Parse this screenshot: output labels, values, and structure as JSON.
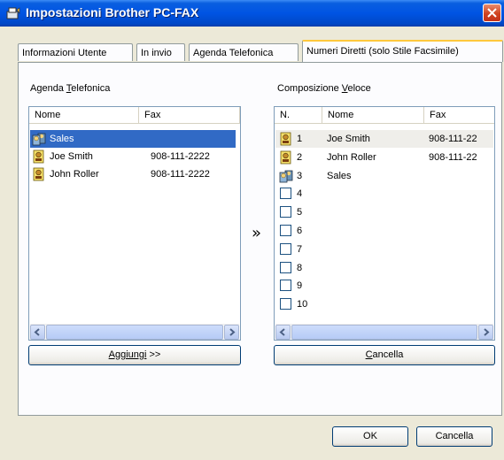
{
  "window": {
    "title": "Impostazioni Brother PC-FAX"
  },
  "tabs": [
    {
      "label": "Informazioni Utente"
    },
    {
      "label": "In invio"
    },
    {
      "label": "Agenda Telefonica"
    },
    {
      "label": "Numeri Diretti (solo Stile Facsimile)"
    }
  ],
  "phonebook": {
    "label": "Agenda Telefonica",
    "label_accel_before": "Agenda ",
    "label_accel": "T",
    "label_accel_after": "elefonica",
    "columns": [
      "Nome",
      "Fax"
    ],
    "rows": [
      {
        "icon": "group-icon",
        "name": "Sales",
        "fax": "",
        "selected": true
      },
      {
        "icon": "person-icon",
        "name": "Joe Smith",
        "fax": "908-111-2222",
        "selected": false
      },
      {
        "icon": "person-icon",
        "name": "John Roller",
        "fax": "908-111-2222",
        "selected": false
      }
    ],
    "add_button": {
      "before": "Aggiungi",
      "after": " >>"
    }
  },
  "transfer_arrow": "»",
  "speed_dial": {
    "label": "Composizione Veloce",
    "label_accel_before": "Composizione ",
    "label_accel": "V",
    "label_accel_after": "eloce",
    "columns": [
      "N.",
      "Nome",
      "Fax"
    ],
    "rows": [
      {
        "icon": "person-icon",
        "num": "1",
        "name": "Joe Smith",
        "fax": "908-111-22"
      },
      {
        "icon": "person-icon",
        "num": "2",
        "name": "John Roller",
        "fax": "908-111-22"
      },
      {
        "icon": "group-icon",
        "num": "3",
        "name": "Sales",
        "fax": ""
      },
      {
        "icon": "empty",
        "num": "4",
        "name": "",
        "fax": ""
      },
      {
        "icon": "empty",
        "num": "5",
        "name": "",
        "fax": ""
      },
      {
        "icon": "empty",
        "num": "6",
        "name": "",
        "fax": ""
      },
      {
        "icon": "empty",
        "num": "7",
        "name": "",
        "fax": ""
      },
      {
        "icon": "empty",
        "num": "8",
        "name": "",
        "fax": ""
      },
      {
        "icon": "empty",
        "num": "9",
        "name": "",
        "fax": ""
      },
      {
        "icon": "empty",
        "num": "10",
        "name": "",
        "fax": ""
      }
    ],
    "delete_button": {
      "accel": "C",
      "after": "ancella"
    }
  },
  "footer": {
    "ok_label": "OK",
    "cancel_label": "Cancella"
  }
}
